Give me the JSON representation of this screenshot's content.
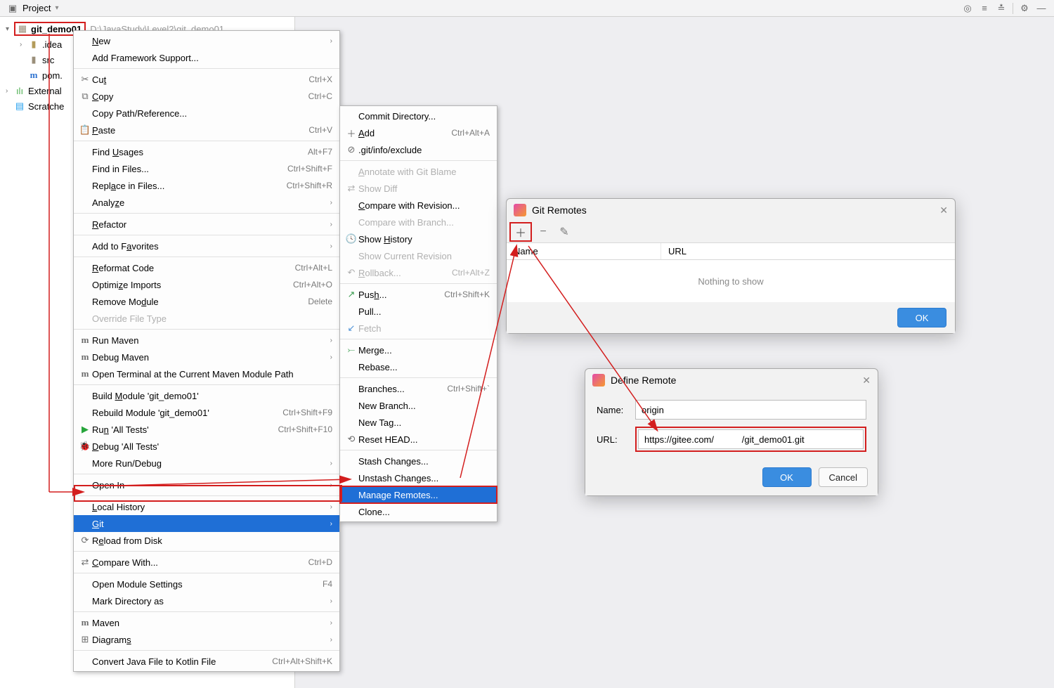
{
  "toolbar": {
    "project_label": "Project"
  },
  "tree": {
    "root": "git_demo01",
    "root_path": "D:\\JavaStudy\\Level2\\git_demo01",
    "idea": ".idea",
    "src": "src",
    "pom": "pom.",
    "external": "External",
    "scratches": "Scratche"
  },
  "menu1": {
    "new": "New",
    "framework": "Add Framework Support...",
    "cut": "Cut",
    "cut_k": "Ctrl+X",
    "copy": "Copy",
    "copy_k": "Ctrl+C",
    "copypath": "Copy Path/Reference...",
    "paste": "Paste",
    "paste_k": "Ctrl+V",
    "findusages": "Find Usages",
    "findusages_k": "Alt+F7",
    "findinfiles": "Find in Files...",
    "findinfiles_k": "Ctrl+Shift+F",
    "replaceinfiles": "Replace in Files...",
    "replaceinfiles_k": "Ctrl+Shift+R",
    "analyze": "Analyze",
    "refactor": "Refactor",
    "addfav": "Add to Favorites",
    "reformat": "Reformat Code",
    "reformat_k": "Ctrl+Alt+L",
    "optimize": "Optimize Imports",
    "optimize_k": "Ctrl+Alt+O",
    "remove": "Remove Module",
    "remove_k": "Delete",
    "override": "Override File Type",
    "runmaven": "Run Maven",
    "debugmaven": "Debug Maven",
    "openterm": "Open Terminal at the Current Maven Module Path",
    "buildmod": "Build Module 'git_demo01'",
    "rebuildmod": "Rebuild Module 'git_demo01'",
    "rebuildmod_k": "Ctrl+Shift+F9",
    "runall": "Run 'All Tests'",
    "runall_k": "Ctrl+Shift+F10",
    "debugall": "Debug 'All Tests'",
    "morerun": "More Run/Debug",
    "openin": "Open In",
    "localhist": "Local History",
    "git": "Git",
    "reload": "Reload from Disk",
    "comparewith": "Compare With...",
    "comparewith_k": "Ctrl+D",
    "openmodset": "Open Module Settings",
    "openmodset_k": "F4",
    "markdir": "Mark Directory as",
    "maven": "Maven",
    "diagrams": "Diagrams",
    "convertkotlin": "Convert Java File to Kotlin File",
    "convertkotlin_k": "Ctrl+Alt+Shift+K"
  },
  "menu2": {
    "commitdir": "Commit Directory...",
    "add": "Add",
    "add_k": "Ctrl+Alt+A",
    "gitinfo": ".git/info/exclude",
    "annotate": "Annotate with Git Blame",
    "showdiff": "Show Diff",
    "comparerev": "Compare with Revision...",
    "comparebranch": "Compare with Branch...",
    "showhist": "Show History",
    "showcurrev": "Show Current Revision",
    "rollback": "Rollback...",
    "rollback_k": "Ctrl+Alt+Z",
    "push": "Push...",
    "push_k": "Ctrl+Shift+K",
    "pull": "Pull...",
    "fetch": "Fetch",
    "merge": "Merge...",
    "rebase": "Rebase...",
    "branches": "Branches...",
    "branches_k": "Ctrl+Shift+`",
    "newbranch": "New Branch...",
    "newtag": "New Tag...",
    "resethead": "Reset HEAD...",
    "stash": "Stash Changes...",
    "unstash": "Unstash Changes...",
    "manage": "Manage Remotes...",
    "clone": "Clone..."
  },
  "remotes": {
    "title": "Git Remotes",
    "col_name": "Name",
    "col_url": "URL",
    "empty": "Nothing to show",
    "ok": "OK"
  },
  "define": {
    "title": "Define Remote",
    "name_label": "Name:",
    "name_value": "origin",
    "url_label": "URL:",
    "url_value": "https://gitee.com/           /git_demo01.git",
    "ok": "OK",
    "cancel": "Cancel"
  }
}
